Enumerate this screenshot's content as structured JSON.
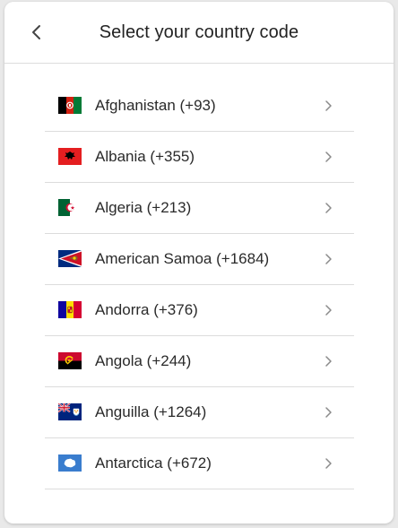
{
  "header": {
    "title": "Select your country code",
    "back_icon": "chevron-left-icon"
  },
  "countries": [
    {
      "label": "Afghanistan (+93)",
      "flag": "afghanistan-flag-icon"
    },
    {
      "label": "Albania (+355)",
      "flag": "albania-flag-icon"
    },
    {
      "label": "Algeria (+213)",
      "flag": "algeria-flag-icon"
    },
    {
      "label": "American Samoa (+1684)",
      "flag": "american-samoa-flag-icon"
    },
    {
      "label": "Andorra (+376)",
      "flag": "andorra-flag-icon"
    },
    {
      "label": "Angola (+244)",
      "flag": "angola-flag-icon"
    },
    {
      "label": "Anguilla (+1264)",
      "flag": "anguilla-flag-icon"
    },
    {
      "label": "Antarctica (+672)",
      "flag": "antarctica-flag-icon"
    }
  ],
  "colors": {
    "divider": "#dcdcdc",
    "chevron": "#8a8a8a",
    "text": "#2a2a2a"
  }
}
